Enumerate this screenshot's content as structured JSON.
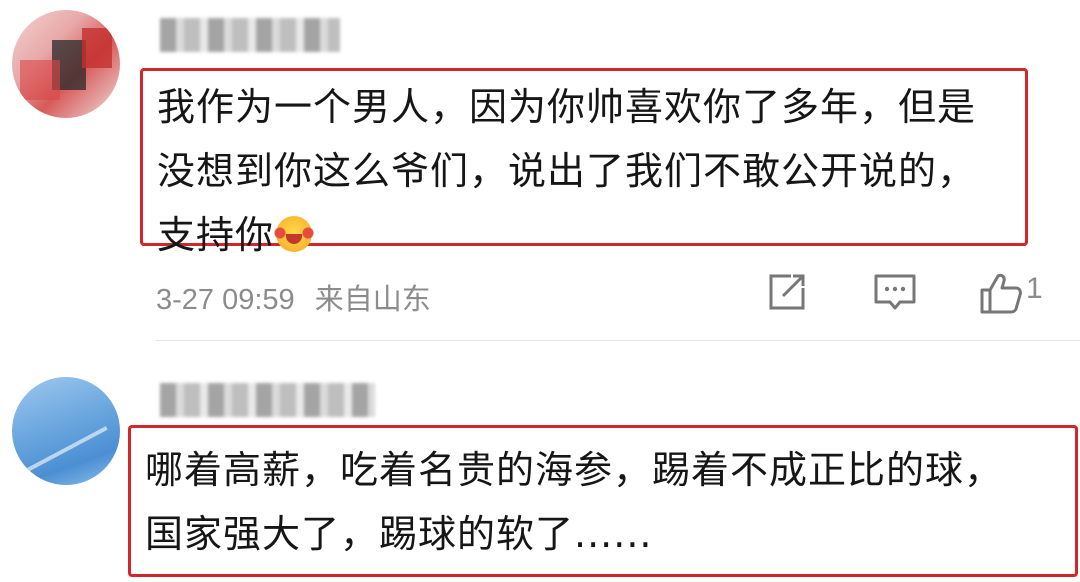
{
  "comments": [
    {
      "username": "",
      "text_lines": [
        "我作为一个男人，因为你帅喜欢你了多年，但是",
        "没想到你这么爷们，说出了我们不敢公开说的，",
        "支持你"
      ],
      "emoji": "crying-laughing-face",
      "time": "3-27 09:59",
      "location": "来自山东",
      "like_count": "1"
    },
    {
      "username": "",
      "text_lines": [
        "哪着高薪，吃着名贵的海参，踢着不成正比的球，",
        "国家强大了，踢球的软了......"
      ]
    }
  ],
  "icons": {
    "share": "share-icon",
    "reply": "comment-icon",
    "like": "thumbs-up-icon"
  },
  "colors": {
    "highlight_border": "#d3262a",
    "meta_text": "#8c8c8c"
  }
}
